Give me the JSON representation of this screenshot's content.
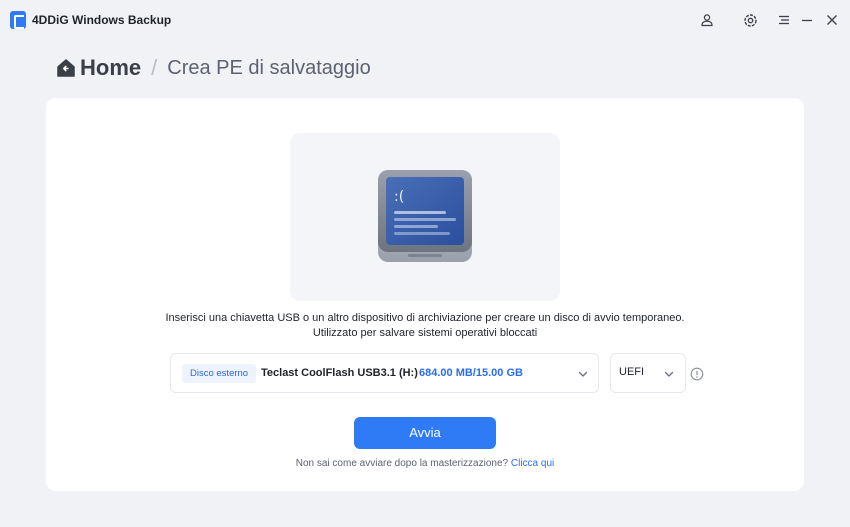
{
  "app": {
    "title": "4DDiG Windows Backup"
  },
  "titlebar": {
    "icons": [
      "user-icon",
      "settings-icon",
      "menu-icon",
      "minimize-icon",
      "close-icon"
    ]
  },
  "breadcrumb": {
    "home": "Home",
    "separator": "/",
    "current": "Crea PE di salvataggio"
  },
  "main": {
    "description_line1": "Inserisci una chiavetta USB o un altro dispositivo di archiviazione per creare un disco di avvio temporaneo.",
    "description_line2": "Utilizzato per salvare sistemi operativi bloccati",
    "illustration_text": ":(",
    "drive": {
      "tag": "Disco esterno",
      "name": "Teclast CoolFlash USB3.1 (H:)",
      "size": "684.00 MB/15.00 GB"
    },
    "boot_mode": {
      "value": "UEFI"
    },
    "start_label": "Avvia",
    "help_text": "Non sai come avviare dopo la masterizzazione?",
    "help_link": "Clicca qui"
  },
  "colors": {
    "accent": "#2f7bf5",
    "background": "#f1f2f6",
    "link": "#2a6fe8"
  }
}
